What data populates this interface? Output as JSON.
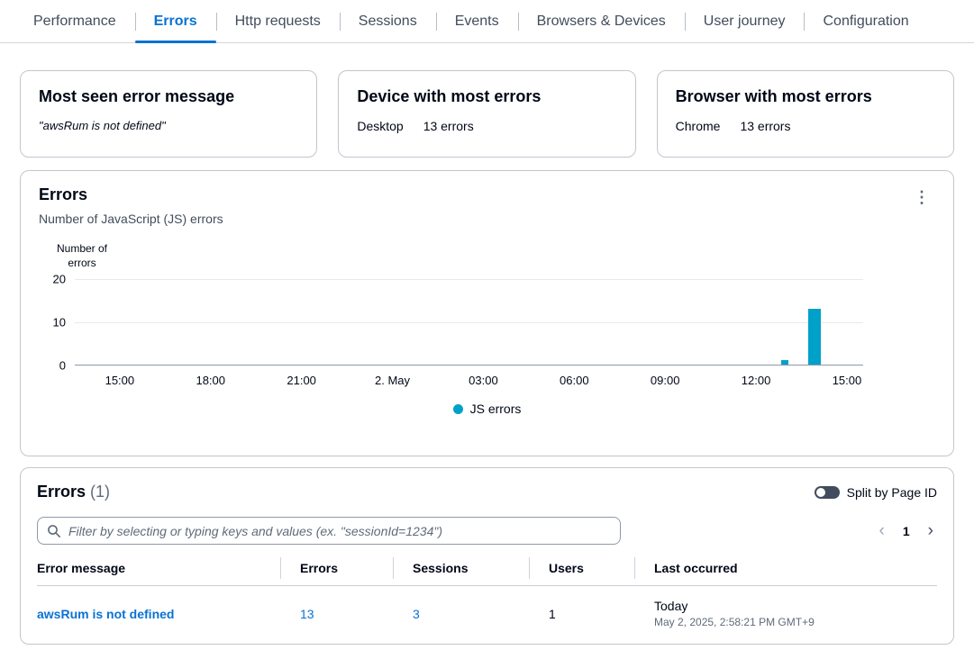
{
  "tabs": {
    "items": [
      {
        "label": "Performance"
      },
      {
        "label": "Errors"
      },
      {
        "label": "Http requests"
      },
      {
        "label": "Sessions"
      },
      {
        "label": "Events"
      },
      {
        "label": "Browsers & Devices"
      },
      {
        "label": "User journey"
      },
      {
        "label": "Configuration"
      }
    ],
    "active": "Errors"
  },
  "summary_cards": {
    "most_seen": {
      "title": "Most seen error message",
      "value": "\"awsRum is not defined\""
    },
    "device": {
      "title": "Device with most errors",
      "label": "Desktop",
      "value": "13 errors"
    },
    "browser": {
      "title": "Browser with most errors",
      "label": "Chrome",
      "value": "13 errors"
    }
  },
  "chart_data": {
    "type": "bar",
    "title": "Errors",
    "subtitle": "Number of JavaScript (JS) errors",
    "ylabel": "Number of errors",
    "ylim": [
      0,
      20
    ],
    "yticks": [
      20,
      10,
      0
    ],
    "xticklabels": [
      "15:00",
      "18:00",
      "21:00",
      "2. May",
      "03:00",
      "06:00",
      "09:00",
      "12:00",
      "15:00"
    ],
    "grid": true,
    "legend_position": "bottom",
    "series": [
      {
        "name": "JS errors",
        "color": "#00a1c9",
        "points": [
          {
            "x": "May 2 ~13:00",
            "y": 1,
            "pos": 0.9,
            "w": 8
          },
          {
            "x": "May 2 ~14:00",
            "y": 13,
            "pos": 0.938,
            "w": 14
          }
        ]
      }
    ]
  },
  "errors_table": {
    "title": "Errors",
    "count": "(1)",
    "split_toggle_label": "Split by Page ID",
    "split_toggle_on": false,
    "filter_placeholder": "Filter by selecting or typing keys and values (ex. \"sessionId=1234\")",
    "pagination": {
      "current_page": "1"
    },
    "columns": [
      "Error message",
      "Errors",
      "Sessions",
      "Users",
      "Last occurred"
    ],
    "rows": [
      {
        "error_message": "awsRum is not defined",
        "errors": "13",
        "sessions": "3",
        "users": "1",
        "last_occurred_relative": "Today",
        "last_occurred_timestamp": "May 2, 2025, 2:58:21 PM GMT+9"
      }
    ]
  },
  "icons": {
    "kebab_menu": "⋮",
    "chevron_left": "‹",
    "chevron_right": "›",
    "search": "magnifier"
  },
  "colors": {
    "accent_blue": "#0972d3",
    "chart_bar": "#00a1c9",
    "panel_border": "#c1c7cd",
    "text_secondary": "#5f6b7a"
  }
}
